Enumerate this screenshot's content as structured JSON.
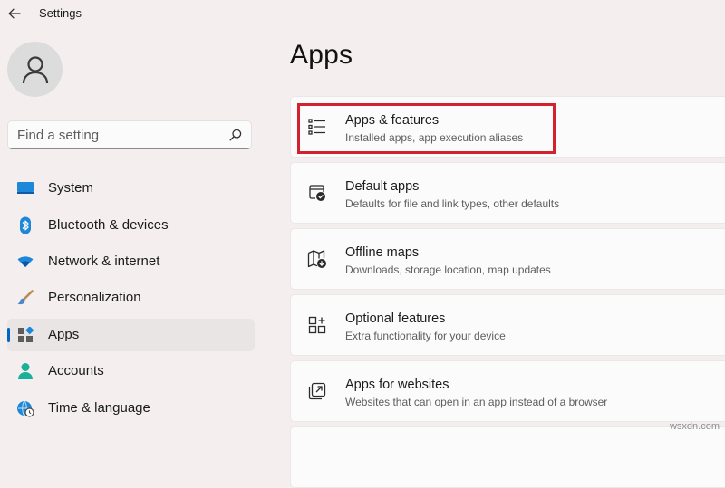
{
  "window": {
    "title": "Settings"
  },
  "search": {
    "placeholder": "Find a setting"
  },
  "sidebar": {
    "items": [
      {
        "label": "System"
      },
      {
        "label": "Bluetooth & devices"
      },
      {
        "label": "Network & internet"
      },
      {
        "label": "Personalization"
      },
      {
        "label": "Apps",
        "selected": true
      },
      {
        "label": "Accounts"
      },
      {
        "label": "Time & language"
      }
    ]
  },
  "main": {
    "title": "Apps",
    "cards": [
      {
        "title": "Apps & features",
        "subtitle": "Installed apps, app execution aliases",
        "highlighted": true
      },
      {
        "title": "Default apps",
        "subtitle": "Defaults for file and link types, other defaults"
      },
      {
        "title": "Offline maps",
        "subtitle": "Downloads, storage location, map updates"
      },
      {
        "title": "Optional features",
        "subtitle": "Extra functionality for your device"
      },
      {
        "title": "Apps for websites",
        "subtitle": "Websites that can open in an app instead of a browser"
      }
    ]
  },
  "watermark": "wsxdn.com",
  "colors": {
    "accent": "#0067c0",
    "highlight_border": "#d1222d",
    "background": "#f4efee"
  }
}
